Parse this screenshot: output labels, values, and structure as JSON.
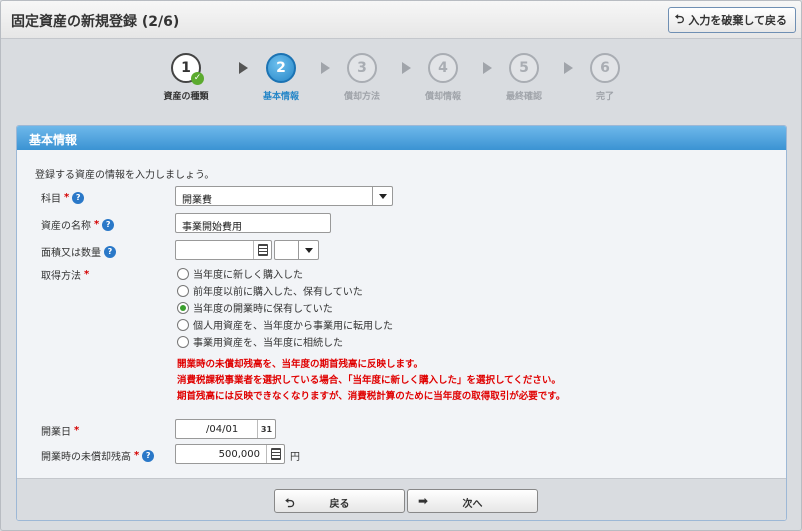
{
  "header": {
    "title": "固定資産の新規登録 (2/6)",
    "discard_label": "入力を破棄して戻る"
  },
  "steps": [
    {
      "num": "1",
      "label": "資産の種類",
      "state": "done"
    },
    {
      "num": "2",
      "label": "基本情報",
      "state": "current"
    },
    {
      "num": "3",
      "label": "償却方法",
      "state": "todo"
    },
    {
      "num": "4",
      "label": "償却情報",
      "state": "todo"
    },
    {
      "num": "5",
      "label": "最終確認",
      "state": "todo"
    },
    {
      "num": "6",
      "label": "完了",
      "state": "todo"
    }
  ],
  "panel": {
    "title": "基本情報",
    "intro": "登録する資産の情報を入力しましょう。"
  },
  "form": {
    "account": {
      "label": "科目",
      "value": "開業費"
    },
    "asset_name": {
      "label": "資産の名称",
      "value": "事業開始費用"
    },
    "quantity": {
      "label": "面積又は数量",
      "value": "",
      "unit_value": ""
    },
    "acquisition": {
      "label": "取得方法",
      "options": [
        "当年度に新しく購入した",
        "前年度以前に購入した、保有していた",
        "当年度の開業時に保有していた",
        "個人用資産を、当年度から事業用に転用した",
        "事業用資産を、当年度に相続した"
      ],
      "selected_index": 2
    },
    "notes": [
      "開業時の未償却残高を、当年度の期首残高に反映します。",
      "消費税課税事業者を選択している場合、「当年度に新しく購入した」を選択してください。",
      "期首残高には反映できなくなりますが、消費税計算のために当年度の取得取引が必要です。"
    ],
    "start_date": {
      "label": "開業日",
      "value": "/04/01"
    },
    "unamortized": {
      "label": "開業時の未償却残高",
      "value": "500,000",
      "unit": "円"
    }
  },
  "footer": {
    "back_label": "戻る",
    "next_label": "次へ"
  },
  "colors": {
    "accent": "#3b93d3",
    "required": "#d40000",
    "radio_selected": "#3aa02e"
  }
}
